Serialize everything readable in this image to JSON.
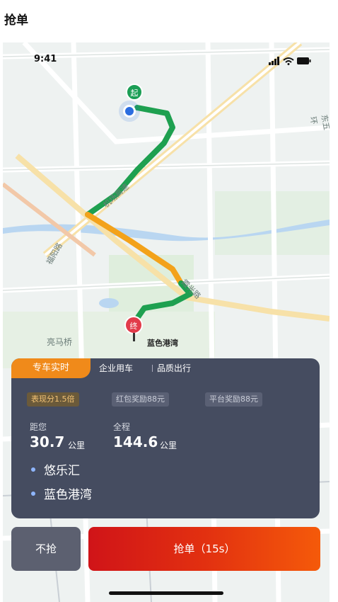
{
  "page": {
    "title": "抢单"
  },
  "status_bar": {
    "time": "9:41"
  },
  "map": {
    "labels": {
      "road_1": "机场高速",
      "road_2": "福阳路",
      "road_3": "东五环",
      "road_4": "霞光路",
      "bridge": "亮马桥",
      "destination": "蓝色港湾"
    },
    "markers": {
      "start": "起",
      "end": "终"
    }
  },
  "order_card": {
    "tabs": {
      "active": "专车实时",
      "second": "企业用车",
      "third": "品质出行"
    },
    "chips": [
      "表现分1.5倍",
      "红包奖励88元",
      "平台奖励88元"
    ],
    "distance": {
      "label": "距您",
      "value": "30.7",
      "unit": "公里"
    },
    "total": {
      "label": "全程",
      "value": "144.6",
      "unit": "公里"
    },
    "pickup": "悠乐汇",
    "dropoff": "蓝色港湾"
  },
  "actions": {
    "decline": "不抢",
    "grab": "抢单（15s）"
  },
  "colors": {
    "route_green": "#1ea050",
    "route_orange": "#f3a21a",
    "card_bg": "#454c60",
    "grab_button": "#e2281a"
  }
}
